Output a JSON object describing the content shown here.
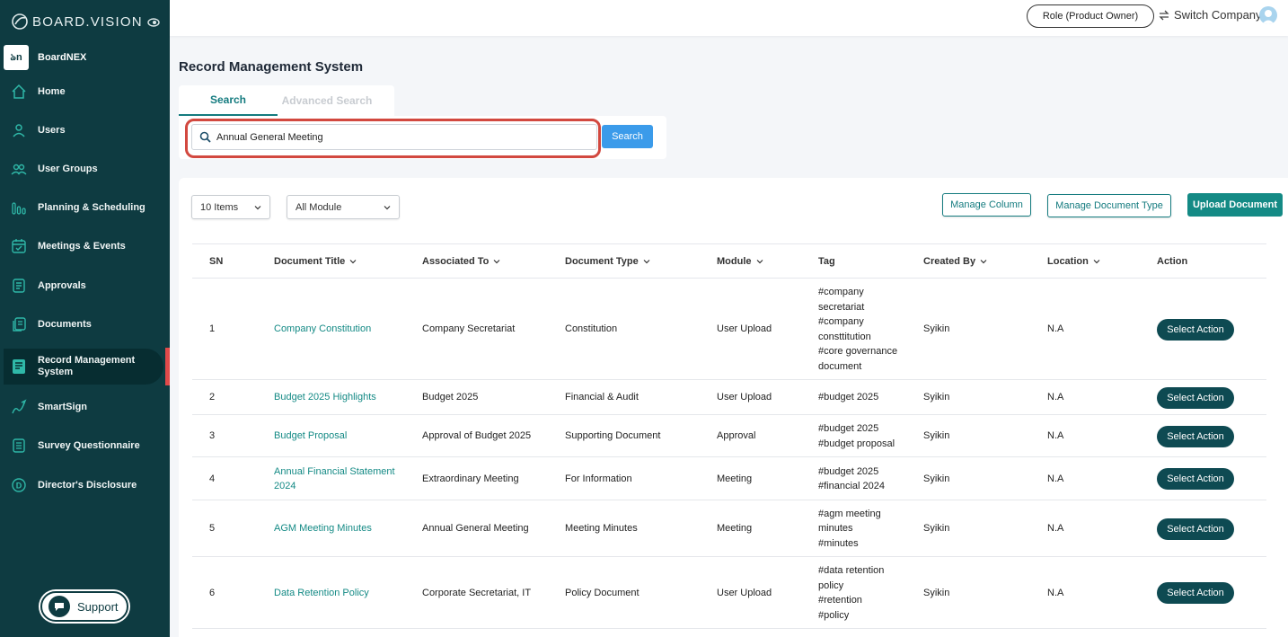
{
  "sidebar": {
    "brand": "BOARD.VISION",
    "company": {
      "logo_text": "ঌn",
      "name": "BoardNEX"
    },
    "items": [
      {
        "label": "Home",
        "icon": "home-icon"
      },
      {
        "label": "Users",
        "icon": "user-icon"
      },
      {
        "label": "User Groups",
        "icon": "user-group-icon"
      },
      {
        "label": "Planning & Scheduling",
        "icon": "bar-chart-icon"
      },
      {
        "label": "Meetings & Events",
        "icon": "calendar-icon"
      },
      {
        "label": "Approvals",
        "icon": "approval-icon"
      },
      {
        "label": "Documents",
        "icon": "documents-icon"
      },
      {
        "label": "Record Management System",
        "icon": "record-icon",
        "active": true
      },
      {
        "label": "SmartSign",
        "icon": "signature-icon"
      },
      {
        "label": "Survey Questionnaire",
        "icon": "survey-icon"
      },
      {
        "label": "Director's Disclosure",
        "icon": "disclosure-icon"
      }
    ],
    "support": "Support"
  },
  "topbar": {
    "role": "Role (Product Owner)",
    "switch_company": "Switch Company"
  },
  "page": {
    "title": "Record Management System",
    "tabs": [
      "Search",
      "Advanced Search"
    ],
    "search_value": "Annual General Meeting",
    "search_button": "Search"
  },
  "toolbar": {
    "items_select": "10 Items",
    "module_select": "All Module",
    "manage_column": "Manage Column",
    "manage_doc_type": "Manage Document Type",
    "upload": "Upload Document"
  },
  "table": {
    "headers": [
      "SN",
      "Document Title",
      "Associated To",
      "Document Type",
      "Module",
      "Tag",
      "Created By",
      "Location",
      "Action"
    ],
    "rows": [
      {
        "sn": "1",
        "title": [
          "Company Constitution"
        ],
        "assoc": "Company Secretariat",
        "type": "Constitution",
        "module": "User Upload",
        "tag": [
          "#company",
          "secretariat",
          "#company",
          "consttitution",
          "#core governance",
          "document"
        ],
        "created_by": "Syikin",
        "location": "N.A",
        "action": "Select Action"
      },
      {
        "sn": "2",
        "title": [
          "Budget 2025 Highlights"
        ],
        "assoc": "Budget 2025",
        "type": "Financial & Audit",
        "module": "User Upload",
        "tag": [
          "#budget 2025"
        ],
        "created_by": "Syikin",
        "location": "N.A",
        "action": "Select Action"
      },
      {
        "sn": "3",
        "title": [
          "Budget Proposal"
        ],
        "assoc": "Approval of Budget 2025",
        "type": "Supporting Document",
        "module": "Approval",
        "tag": [
          "#budget 2025",
          "#budget proposal"
        ],
        "created_by": "Syikin",
        "location": "N.A",
        "action": "Select Action"
      },
      {
        "sn": "4",
        "title": [
          "Annual Financial Statement",
          "2024"
        ],
        "assoc": "Extraordinary Meeting",
        "type": "For Information",
        "module": "Meeting",
        "tag": [
          "#budget 2025",
          "#financial 2024"
        ],
        "created_by": "Syikin",
        "location": "N.A",
        "action": "Select Action"
      },
      {
        "sn": "5",
        "title": [
          "AGM Meeting Minutes"
        ],
        "assoc": "Annual General Meeting",
        "type": "Meeting Minutes",
        "module": "Meeting",
        "tag": [
          "#agm meeting",
          "minutes",
          "#minutes"
        ],
        "created_by": "Syikin",
        "location": "N.A",
        "action": "Select Action"
      },
      {
        "sn": "6",
        "title": [
          "Data Retention Policy"
        ],
        "assoc": "Corporate Secretariat, IT",
        "type": "Policy Document",
        "module": "User Upload",
        "tag": [
          "#data retention",
          "policy",
          "#retention",
          "#policy"
        ],
        "created_by": "Syikin",
        "location": "N.A",
        "action": "Select Action"
      }
    ]
  },
  "colors": {
    "sidebar": "#0e3b41",
    "accent": "#148a85",
    "search_button": "#3b9bea",
    "highlight": "#d2483f"
  }
}
